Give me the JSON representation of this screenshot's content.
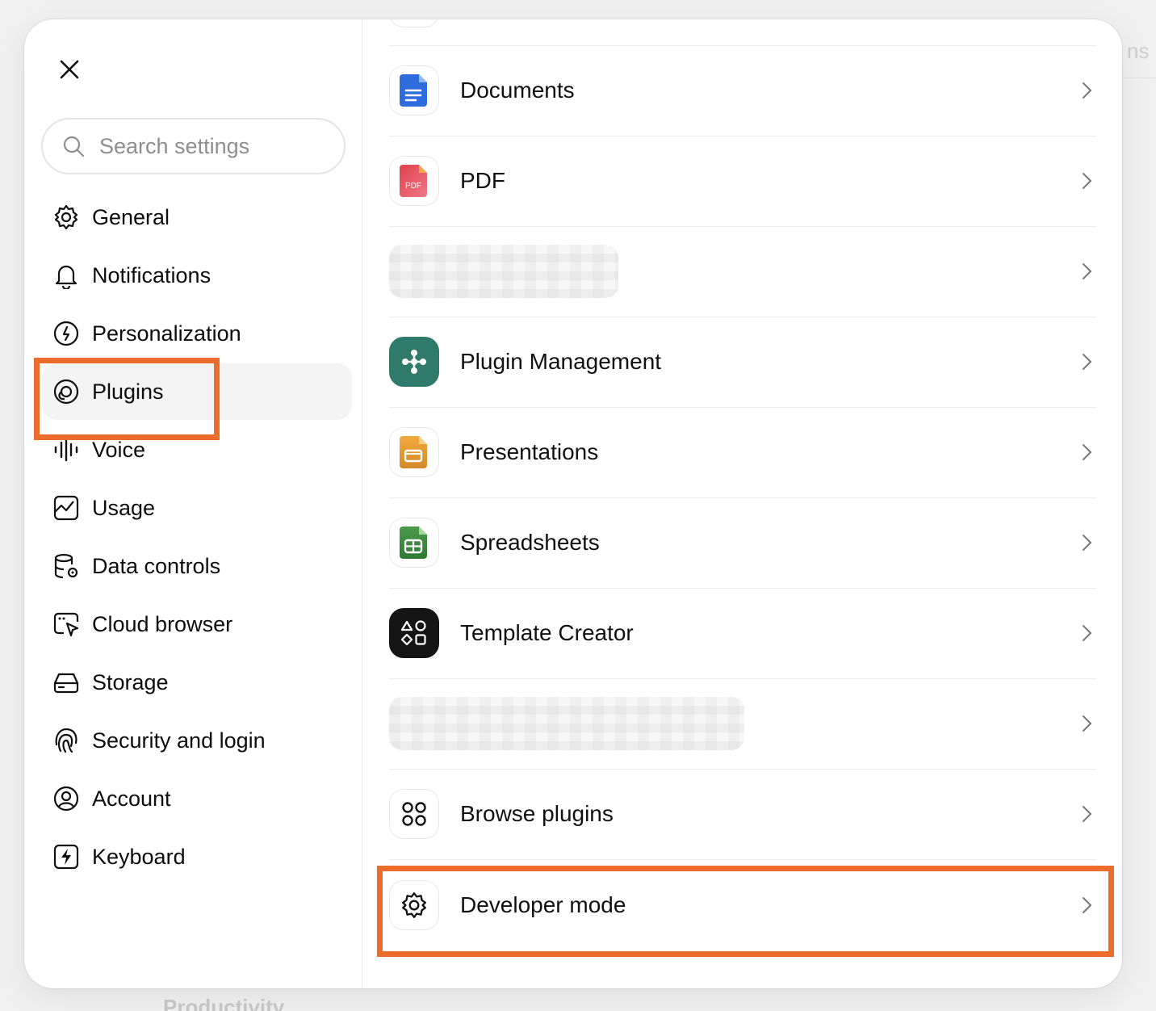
{
  "background": {
    "right_fragment": "ns",
    "bottom_fragment": "Productivity"
  },
  "sidebar": {
    "search_placeholder": "Search settings",
    "items": [
      {
        "label": "General",
        "icon": "gear-icon"
      },
      {
        "label": "Notifications",
        "icon": "bell-icon"
      },
      {
        "label": "Personalization",
        "icon": "personalization-icon"
      },
      {
        "label": "Plugins",
        "icon": "plugins-icon",
        "active": true
      },
      {
        "label": "Voice",
        "icon": "voice-waveform-icon"
      },
      {
        "label": "Usage",
        "icon": "usage-chart-icon"
      },
      {
        "label": "Data controls",
        "icon": "database-gear-icon"
      },
      {
        "label": "Cloud browser",
        "icon": "cloud-browser-icon"
      },
      {
        "label": "Storage",
        "icon": "storage-drive-icon"
      },
      {
        "label": "Security and login",
        "icon": "fingerprint-icon"
      },
      {
        "label": "Account",
        "icon": "account-icon"
      },
      {
        "label": "Keyboard",
        "icon": "keyboard-shortcut-icon"
      }
    ]
  },
  "plugins": [
    {
      "label": "Documents",
      "icon": "documents-icon"
    },
    {
      "label": "PDF",
      "icon": "pdf-icon",
      "icon_text": "PDF"
    },
    {
      "label": "",
      "icon": "redacted",
      "redacted": true
    },
    {
      "label": "Plugin Management",
      "icon": "plugin-management-icon"
    },
    {
      "label": "Presentations",
      "icon": "presentations-icon"
    },
    {
      "label": "Spreadsheets",
      "icon": "spreadsheets-icon"
    },
    {
      "label": "Template Creator",
      "icon": "template-creator-icon"
    },
    {
      "label": "",
      "icon": "redacted",
      "redacted": true
    },
    {
      "label": "Browse plugins",
      "icon": "browse-plugins-icon"
    },
    {
      "label": "Developer mode",
      "icon": "gear-icon"
    }
  ],
  "colors": {
    "highlight": "#ec6c2c",
    "active_bg": "#f4f4f4",
    "teal": "#2f7a6a"
  }
}
